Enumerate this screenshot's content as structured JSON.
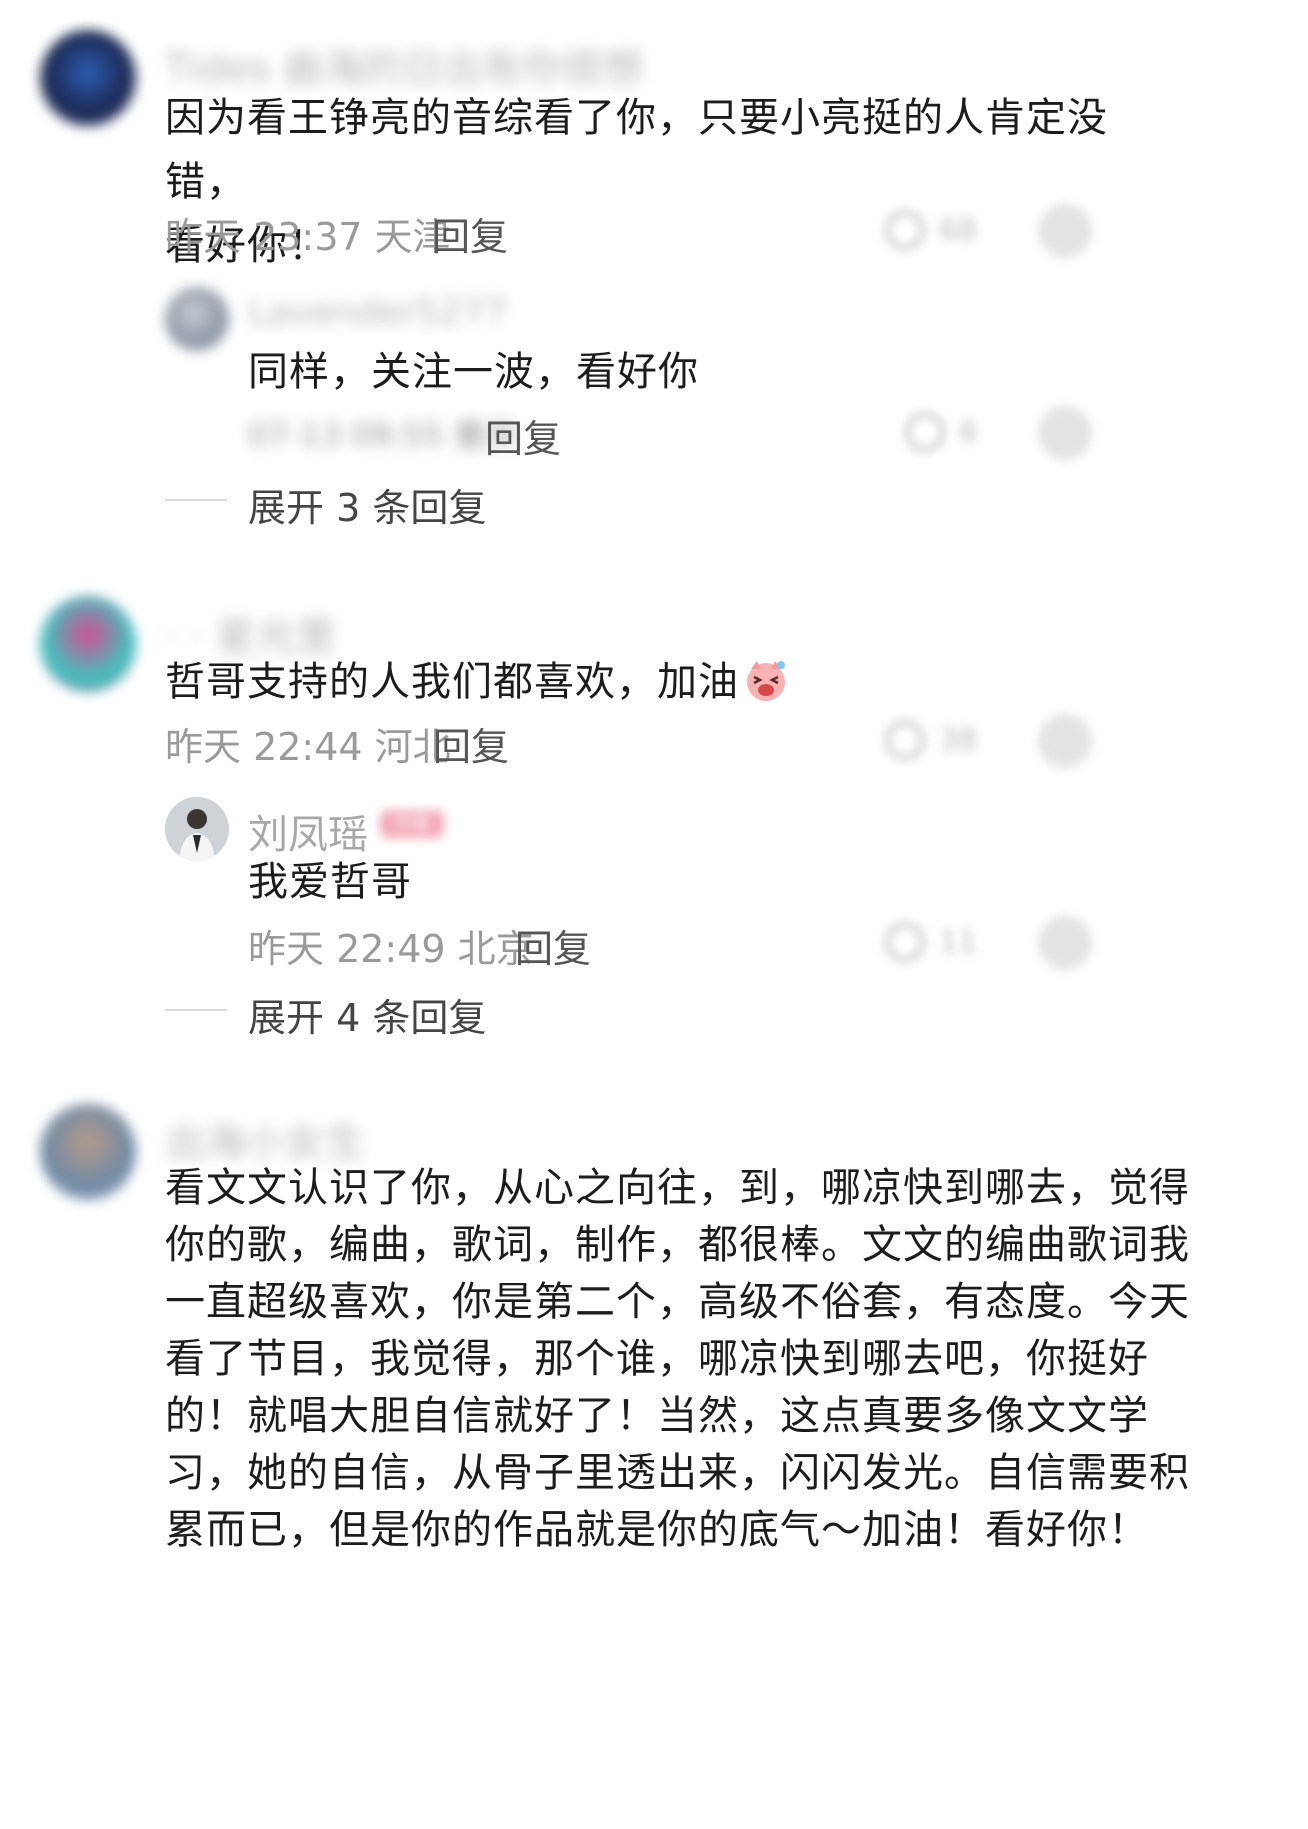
{
  "comments": [
    {
      "username": "Tides 曲海的日出有你很想",
      "text_line1": "因为看王铮亮的音综看了你，只要小亮挺的人肯定没错，",
      "text_line2": "看好你！",
      "time": "昨天 23:37 天津",
      "reply_label": "回复",
      "likes": "68",
      "reply": {
        "username": "Lavender5277",
        "text": "同样，关注一波，看好你",
        "time": "07-13 09:55 重庆",
        "reply_label": "回复",
        "likes": "6"
      },
      "expand_label": "展开 3 条回复"
    },
    {
      "username": "· · 星光里",
      "text": "哲哥支持的人我们都喜欢，加油",
      "time": "昨天 22:44 河北",
      "reply_label": "回复",
      "likes": "38",
      "reply": {
        "username": "刘凤瑶",
        "badge": "作者",
        "text": "我爱哲哥",
        "time": "昨天 22:49 北京",
        "reply_label": "回复",
        "likes": "11"
      },
      "expand_label": "展开 4 条回复"
    },
    {
      "username": "出海小女生",
      "lines": [
        "看文文认识了你，从心之向往，到，哪凉快到哪去，觉得",
        "你的歌，编曲，歌词，制作，都很棒。文文的编曲歌词我",
        "一直超级喜欢，你是第二个，高级不俗套，有态度。今天",
        "看了节目，我觉得，那个谁，哪凉快到哪去吧，你挺好",
        "的！就唱大胆自信就好了！当然，这点真要多像文文学",
        "习，她的自信，从骨子里透出来，闪闪发光。自信需要积",
        "累而已，但是你的作品就是你的底气～加油！看好你！"
      ]
    }
  ],
  "icons": {
    "like": "heart-icon",
    "dislike": "dislike-icon",
    "emoji": "laughing-pig-emoji"
  },
  "colors": {
    "text": "#1c1c1c",
    "meta": "#9a9a9a",
    "badge": "#f3a9b6"
  }
}
